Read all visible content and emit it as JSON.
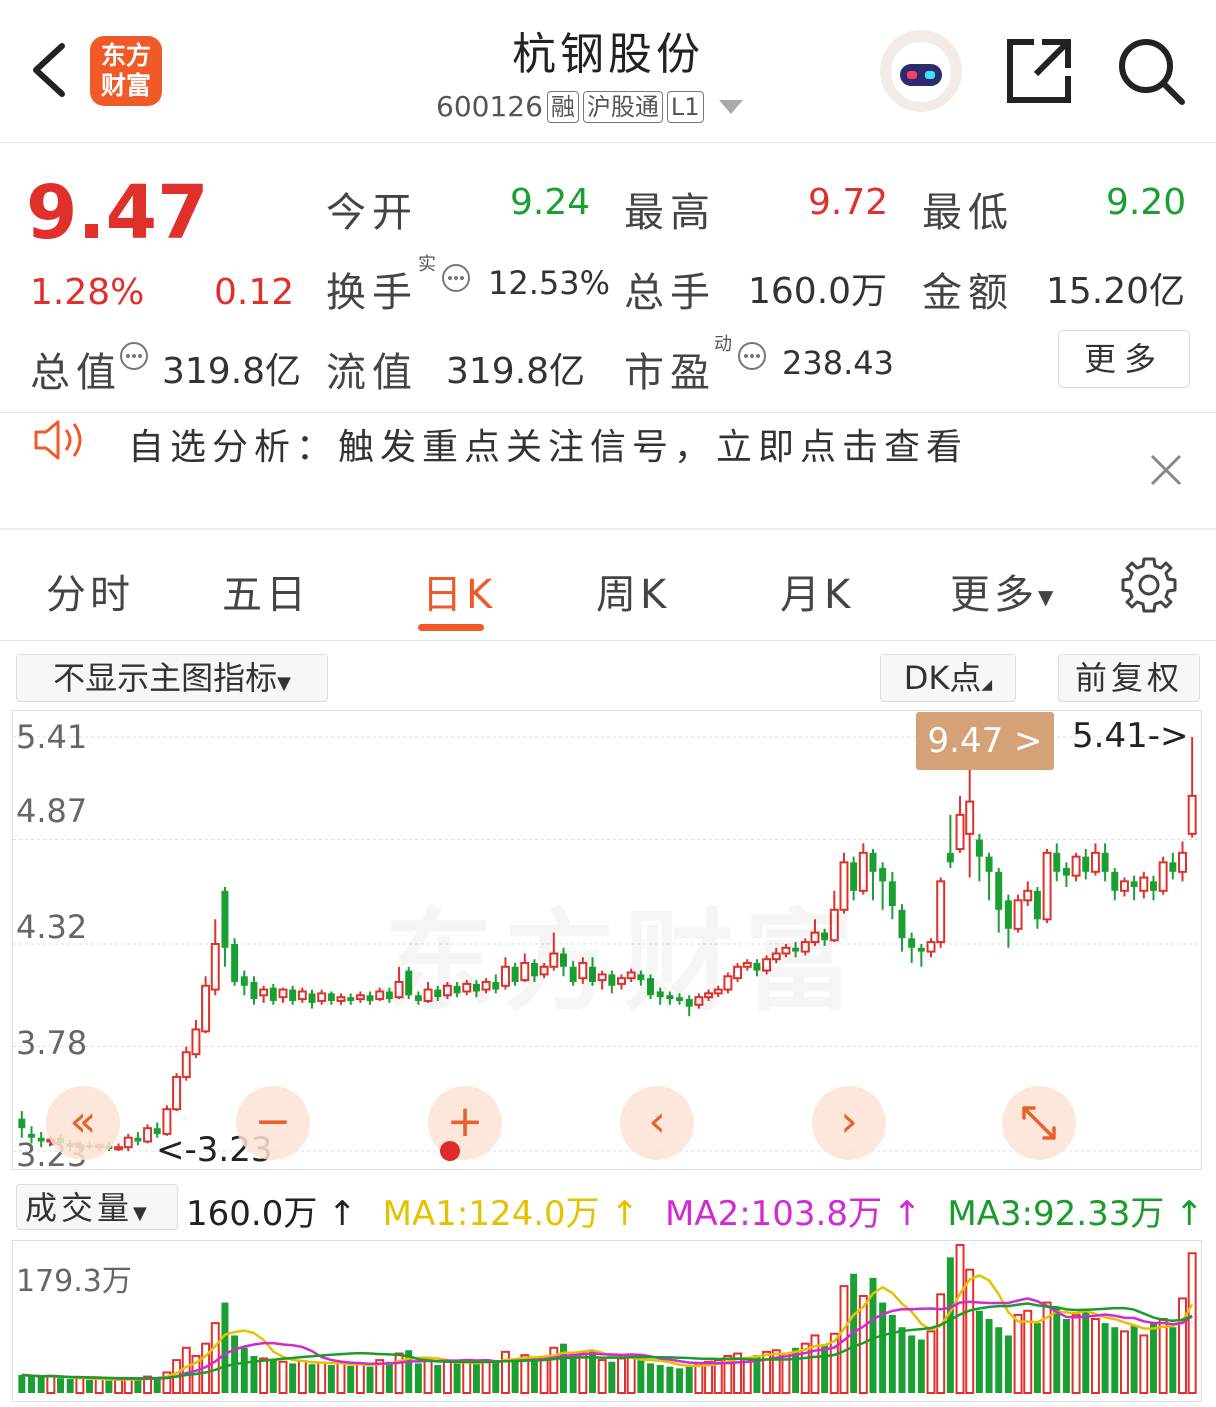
{
  "header": {
    "logo_text": "东方财富",
    "title": "杭钢股份",
    "code": "600126",
    "tags": [
      "融",
      "沪股通",
      "L1"
    ]
  },
  "quote": {
    "price": "9.47",
    "change_pct": "1.28%",
    "change": "0.12",
    "open_label": "今开",
    "open": "9.24",
    "high_label": "最高",
    "high": "9.72",
    "low_label": "最低",
    "low": "9.20",
    "turnover_label": "换手",
    "turnover_sup": "实",
    "turnover": "12.53%",
    "volume_label": "总手",
    "volume": "160.0万",
    "amount_label": "金额",
    "amount": "15.20亿",
    "mktcap_label": "总值",
    "mktcap": "319.8亿",
    "float_label": "流值",
    "float_cap": "319.8亿",
    "pe_label": "市盈",
    "pe_sup": "动",
    "pe": "238.43",
    "more_label": "更多"
  },
  "notice": {
    "text": "自选分析：触发重点关注信号，立即点击查看"
  },
  "tabs": [
    {
      "label": "分时"
    },
    {
      "label": "五日"
    },
    {
      "label": "日K",
      "active": true
    },
    {
      "label": "周K"
    },
    {
      "label": "月K"
    },
    {
      "label": "更多"
    }
  ],
  "chart_controls": {
    "indicator": "不显示主图指标",
    "dk": "DK点",
    "adjust": "前复权"
  },
  "chart_data": {
    "type": "candlestick",
    "y_ticks": [
      "5.41",
      "4.87",
      "4.32",
      "3.78",
      "3.23"
    ],
    "ylim": [
      3.23,
      5.41
    ],
    "max_label": "5.41->",
    "min_label": "<-3.23",
    "price_flag": "9.47 >",
    "watermark": "东方财富",
    "candles": [
      [
        3.4,
        3.35,
        3.44,
        3.3
      ],
      [
        3.32,
        3.3,
        3.36,
        3.27
      ],
      [
        3.3,
        3.28,
        3.33,
        3.25
      ],
      [
        3.28,
        3.29,
        3.31,
        3.26
      ],
      [
        3.3,
        3.27,
        3.32,
        3.25
      ],
      [
        3.27,
        3.25,
        3.29,
        3.23
      ],
      [
        3.25,
        3.26,
        3.28,
        3.23
      ],
      [
        3.26,
        3.25,
        3.28,
        3.24
      ],
      [
        3.25,
        3.26,
        3.27,
        3.23
      ],
      [
        3.26,
        3.24,
        3.28,
        3.23
      ],
      [
        3.24,
        3.25,
        3.27,
        3.23
      ],
      [
        3.25,
        3.3,
        3.32,
        3.23
      ],
      [
        3.3,
        3.28,
        3.33,
        3.26
      ],
      [
        3.28,
        3.35,
        3.37,
        3.27
      ],
      [
        3.35,
        3.32,
        3.38,
        3.3
      ],
      [
        3.32,
        3.45,
        3.47,
        3.31
      ],
      [
        3.45,
        3.62,
        3.64,
        3.44
      ],
      [
        3.62,
        3.75,
        3.78,
        3.6
      ],
      [
        3.74,
        3.87,
        3.92,
        3.72
      ],
      [
        3.86,
        4.1,
        4.15,
        3.85
      ],
      [
        4.08,
        4.32,
        4.45,
        4.05
      ],
      [
        4.6,
        4.3,
        4.62,
        4.2
      ],
      [
        4.32,
        4.12,
        4.35,
        4.1
      ],
      [
        4.15,
        4.1,
        4.18,
        4.05
      ],
      [
        4.12,
        4.03,
        4.15,
        4.0
      ],
      [
        4.05,
        4.08,
        4.1,
        4.01
      ],
      [
        4.09,
        4.02,
        4.11,
        4.0
      ],
      [
        4.04,
        4.08,
        4.09,
        4.01
      ],
      [
        4.08,
        4.02,
        4.1,
        4.0
      ],
      [
        4.03,
        4.07,
        4.09,
        4.01
      ],
      [
        4.06,
        4.01,
        4.08,
        3.98
      ],
      [
        4.02,
        4.06,
        4.08,
        4.0
      ],
      [
        4.06,
        4.02,
        4.07,
        4.0
      ],
      [
        4.02,
        4.04,
        4.06,
        4.0
      ],
      [
        4.04,
        4.02,
        4.06,
        4.0
      ],
      [
        4.03,
        4.05,
        4.07,
        4.01
      ],
      [
        4.05,
        4.02,
        4.07,
        4.0
      ],
      [
        4.03,
        4.07,
        4.09,
        4.02
      ],
      [
        4.07,
        4.03,
        4.09,
        4.01
      ],
      [
        4.04,
        4.12,
        4.2,
        4.03
      ],
      [
        4.18,
        4.05,
        4.2,
        4.03
      ],
      [
        4.05,
        4.02,
        4.07,
        4.0
      ],
      [
        4.02,
        4.08,
        4.12,
        4.01
      ],
      [
        4.08,
        4.04,
        4.1,
        4.02
      ],
      [
        4.05,
        4.1,
        4.12,
        4.03
      ],
      [
        4.1,
        4.06,
        4.12,
        4.04
      ],
      [
        4.07,
        4.11,
        4.13,
        4.05
      ],
      [
        4.11,
        4.07,
        4.13,
        4.04
      ],
      [
        4.08,
        4.12,
        4.14,
        4.06
      ],
      [
        4.12,
        4.08,
        4.16,
        4.06
      ],
      [
        4.1,
        4.2,
        4.25,
        4.08
      ],
      [
        4.2,
        4.12,
        4.22,
        4.1
      ],
      [
        4.13,
        4.22,
        4.27,
        4.12
      ],
      [
        4.22,
        4.15,
        4.24,
        4.12
      ],
      [
        4.16,
        4.2,
        4.22,
        4.14
      ],
      [
        4.2,
        4.27,
        4.38,
        4.18
      ],
      [
        4.27,
        4.2,
        4.3,
        4.15
      ],
      [
        4.2,
        4.12,
        4.23,
        4.1
      ],
      [
        4.14,
        4.22,
        4.25,
        4.11
      ],
      [
        4.2,
        4.12,
        4.25,
        4.1
      ],
      [
        4.13,
        4.16,
        4.18,
        4.08
      ],
      [
        4.16,
        4.1,
        4.18,
        4.06
      ],
      [
        4.11,
        4.14,
        4.16,
        4.08
      ],
      [
        4.14,
        4.17,
        4.19,
        4.12
      ],
      [
        4.16,
        4.13,
        4.18,
        4.1
      ],
      [
        4.14,
        4.05,
        4.16,
        4.03
      ],
      [
        4.07,
        4.04,
        4.09,
        4.0
      ],
      [
        4.05,
        4.03,
        4.07,
        4.0
      ],
      [
        4.04,
        4.02,
        4.06,
        4.0
      ],
      [
        4.03,
        3.99,
        4.05,
        3.94
      ],
      [
        4.0,
        4.04,
        4.06,
        3.98
      ],
      [
        4.04,
        4.06,
        4.08,
        4.02
      ],
      [
        4.06,
        4.08,
        4.1,
        4.04
      ],
      [
        4.08,
        4.15,
        4.17,
        4.06
      ],
      [
        4.14,
        4.2,
        4.22,
        4.12
      ],
      [
        4.2,
        4.22,
        4.24,
        4.18
      ],
      [
        4.22,
        4.18,
        4.24,
        4.15
      ],
      [
        4.18,
        4.24,
        4.26,
        4.16
      ],
      [
        4.24,
        4.27,
        4.3,
        4.22
      ],
      [
        4.27,
        4.3,
        4.32,
        4.25
      ],
      [
        4.3,
        4.28,
        4.33,
        4.25
      ],
      [
        4.28,
        4.33,
        4.35,
        4.26
      ],
      [
        4.33,
        4.38,
        4.45,
        4.31
      ],
      [
        4.38,
        4.34,
        4.4,
        4.31
      ],
      [
        4.34,
        4.5,
        4.6,
        4.33
      ],
      [
        4.5,
        4.75,
        4.8,
        4.48
      ],
      [
        4.75,
        4.6,
        4.78,
        4.55
      ],
      [
        4.6,
        4.8,
        4.85,
        4.58
      ],
      [
        4.8,
        4.7,
        4.82,
        4.55
      ],
      [
        4.72,
        4.65,
        4.75,
        4.5
      ],
      [
        4.65,
        4.52,
        4.7,
        4.45
      ],
      [
        4.5,
        4.35,
        4.53,
        4.28
      ],
      [
        4.35,
        4.3,
        4.38,
        4.22
      ],
      [
        4.3,
        4.28,
        4.32,
        4.2
      ],
      [
        4.28,
        4.33,
        4.35,
        4.25
      ],
      [
        4.33,
        4.65,
        4.67,
        4.3
      ],
      [
        4.8,
        4.75,
        5.0,
        4.72
      ],
      [
        4.82,
        5.0,
        5.1,
        4.8
      ],
      [
        4.9,
        5.07,
        5.41,
        4.67
      ],
      [
        4.87,
        4.78,
        4.9,
        4.65
      ],
      [
        4.78,
        4.7,
        4.8,
        4.55
      ],
      [
        4.7,
        4.5,
        4.72,
        4.38
      ],
      [
        4.55,
        4.4,
        4.58,
        4.3
      ],
      [
        4.4,
        4.55,
        4.58,
        4.38
      ],
      [
        4.55,
        4.6,
        4.65,
        4.52
      ],
      [
        4.6,
        4.45,
        4.62,
        4.4
      ],
      [
        4.45,
        4.8,
        4.82,
        4.43
      ],
      [
        4.8,
        4.7,
        4.85,
        4.65
      ],
      [
        4.72,
        4.68,
        4.75,
        4.62
      ],
      [
        4.68,
        4.78,
        4.8,
        4.65
      ],
      [
        4.78,
        4.7,
        4.82,
        4.66
      ],
      [
        4.7,
        4.8,
        4.85,
        4.68
      ],
      [
        4.8,
        4.7,
        4.85,
        4.65
      ],
      [
        4.7,
        4.6,
        4.72,
        4.55
      ],
      [
        4.6,
        4.65,
        4.67,
        4.57
      ],
      [
        4.65,
        4.62,
        4.68,
        4.55
      ],
      [
        4.6,
        4.67,
        4.7,
        4.56
      ],
      [
        4.65,
        4.6,
        4.68,
        4.55
      ],
      [
        4.6,
        4.75,
        4.78,
        4.58
      ],
      [
        4.75,
        4.7,
        4.8,
        4.66
      ],
      [
        4.7,
        4.8,
        4.86,
        4.65
      ],
      [
        4.9,
        5.1,
        5.41,
        4.88
      ]
    ],
    "volumes": [
      22,
      20,
      19,
      21,
      18,
      17,
      18,
      16,
      17,
      15,
      16,
      18,
      17,
      20,
      19,
      25,
      40,
      55,
      45,
      60,
      85,
      110,
      70,
      55,
      45,
      42,
      40,
      38,
      36,
      39,
      35,
      37,
      34,
      36,
      33,
      35,
      32,
      40,
      38,
      48,
      52,
      36,
      40,
      34,
      38,
      36,
      39,
      35,
      40,
      38,
      50,
      42,
      46,
      40,
      44,
      55,
      60,
      45,
      48,
      52,
      40,
      38,
      42,
      44,
      40,
      36,
      34,
      32,
      30,
      33,
      36,
      38,
      40,
      45,
      48,
      42,
      46,
      50,
      52,
      48,
      55,
      60,
      70,
      58,
      72,
      130,
      145,
      118,
      140,
      110,
      95,
      80,
      70,
      65,
      75,
      120,
      165,
      180,
      150,
      100,
      90,
      80,
      70,
      95,
      100,
      85,
      110,
      105,
      90,
      95,
      100,
      90,
      85,
      80,
      75,
      82,
      70,
      85,
      90,
      80,
      115,
      170
    ],
    "ma_lines": [
      {
        "name": "MA1",
        "color": "#e5c200"
      },
      {
        "name": "MA2",
        "color": "#d22ad2"
      },
      {
        "name": "MA3",
        "color": "#1a9c2c"
      }
    ]
  },
  "volume_panel": {
    "selector": "成交量",
    "vol": "160.0万",
    "ma1": "MA1:124.0万",
    "ma2": "MA2:103.8万",
    "ma3": "MA3:92.33万",
    "max": "179.3万",
    "arrow": "↑"
  },
  "colors": {
    "up": "#e0302c",
    "down": "#1aa032",
    "accent": "#f05a28"
  }
}
